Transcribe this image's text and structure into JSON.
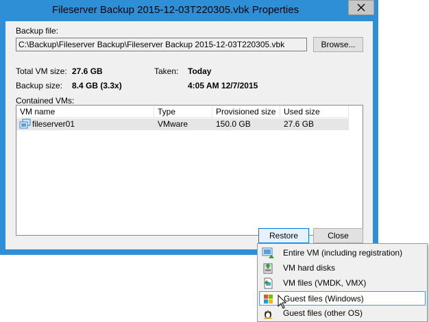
{
  "window": {
    "title": "Fileserver Backup 2015-12-03T220305.vbk Properties",
    "close_icon": "close-icon"
  },
  "backup_file": {
    "label": "Backup file:",
    "path": "C:\\Backup\\Fileserver Backup\\Fileserver Backup 2015-12-03T220305.vbk",
    "browse_label": "Browse..."
  },
  "info": {
    "total_vm_size_label": "Total VM size:",
    "total_vm_size_value": "27.6 GB",
    "backup_size_label": "Backup size:",
    "backup_size_value": "8.4 GB (3.3x)",
    "taken_label": "Taken:",
    "taken_day": "Today",
    "taken_time": "4:05 AM 12/7/2015"
  },
  "contained_vms": {
    "label": "Contained VMs:",
    "columns": [
      "VM name",
      "Type",
      "Provisioned size",
      "Used size"
    ],
    "rows": [
      {
        "name": "fileserver01",
        "type": "VMware",
        "provisioned": "150.0 GB",
        "used": "27.6 GB",
        "icon": "vm-icon"
      }
    ]
  },
  "buttons": {
    "restore": "Restore",
    "close": "Close"
  },
  "restore_menu": {
    "items": [
      {
        "label": "Entire VM (including registration)",
        "icon": "entire-vm-icon"
      },
      {
        "label": "VM hard disks",
        "icon": "vm-hard-disks-icon"
      },
      {
        "label": "VM files (VMDK, VMX)",
        "icon": "vm-files-icon"
      },
      {
        "label": "Guest files (Windows)",
        "icon": "windows-icon"
      },
      {
        "label": "Guest files (other OS)",
        "icon": "linux-icon"
      }
    ],
    "highlighted_index": 3
  },
  "colors": {
    "title_bar": "#2e8fd6",
    "dialog_bg": "#f0f0f0",
    "selected_row": "#e6e6e6",
    "menu_hover_border": "#4b97e0"
  }
}
